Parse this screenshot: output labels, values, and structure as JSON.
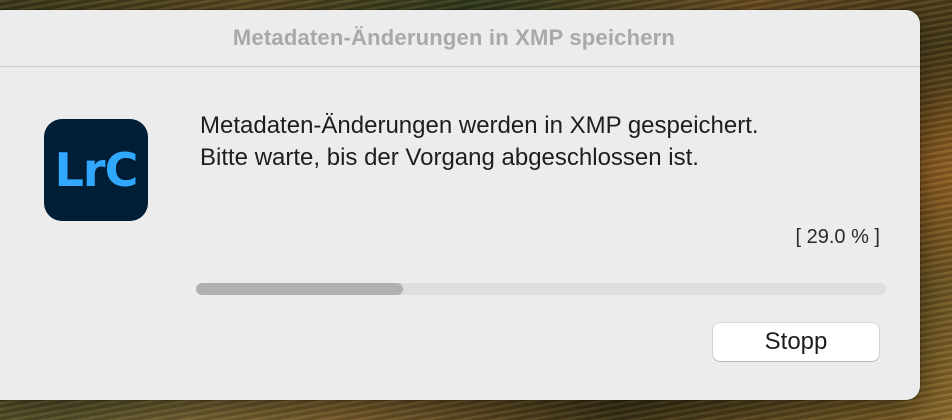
{
  "dialog": {
    "title": "Metadaten-Änderungen in XMP speichern",
    "app_icon": {
      "name": "lightroom-classic-icon",
      "label": "LrC",
      "bg_color": "#001e36",
      "text_color": "#31a8ff"
    },
    "message": {
      "line1": "Metadaten-Änderungen werden in XMP gespeichert.",
      "line2": "Bitte warte, bis der Vorgang abgeschlossen ist."
    },
    "progress": {
      "percent_text": "[ 29.0 % ]",
      "value": 0.3
    },
    "stop_button_label": "Stopp"
  }
}
